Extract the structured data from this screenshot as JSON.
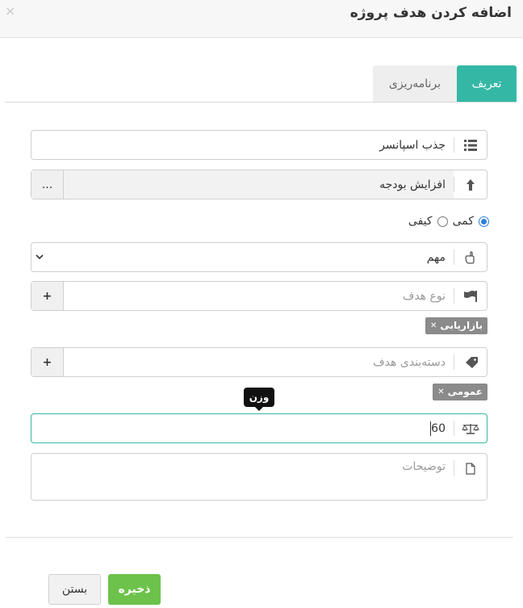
{
  "header": {
    "title": "اضافه کردن هدف پروژه",
    "close_label": "×"
  },
  "tabs": [
    {
      "label": "تعریف",
      "active": true
    },
    {
      "label": "برنامه‌ریزی",
      "active": false
    }
  ],
  "form": {
    "goal_name": {
      "value": "جذب اسپانسر",
      "icon": "list-icon"
    },
    "parent_goal": {
      "value": "افزایش بودجه",
      "icon": "arrow-up-icon",
      "button_label": "..."
    },
    "measure_type": {
      "options": [
        {
          "label": "کمی",
          "checked": true
        },
        {
          "label": "کیفی",
          "checked": false
        }
      ]
    },
    "priority": {
      "value": "مهم",
      "icon": "pointer-hand-icon"
    },
    "goal_type": {
      "placeholder": "نوع هدف",
      "icon": "flag-icon",
      "add_label": "+",
      "tags": [
        "بازاریابی"
      ]
    },
    "goal_category": {
      "placeholder": "دسته‌بندی هدف",
      "icon": "tag-icon",
      "add_label": "+",
      "tags": [
        "عمومی"
      ]
    },
    "weight": {
      "value": "60",
      "icon": "balance-scale-icon",
      "tooltip": "وزن"
    },
    "description": {
      "placeholder": "توضیحات",
      "icon": "document-icon"
    }
  },
  "footer": {
    "save_label": "ذخیره",
    "close_label": "بستن"
  },
  "colors": {
    "accent": "#34b8a5",
    "save": "#6cc24a",
    "radio": "#2a7ed8",
    "chip": "#8b8b8b"
  }
}
